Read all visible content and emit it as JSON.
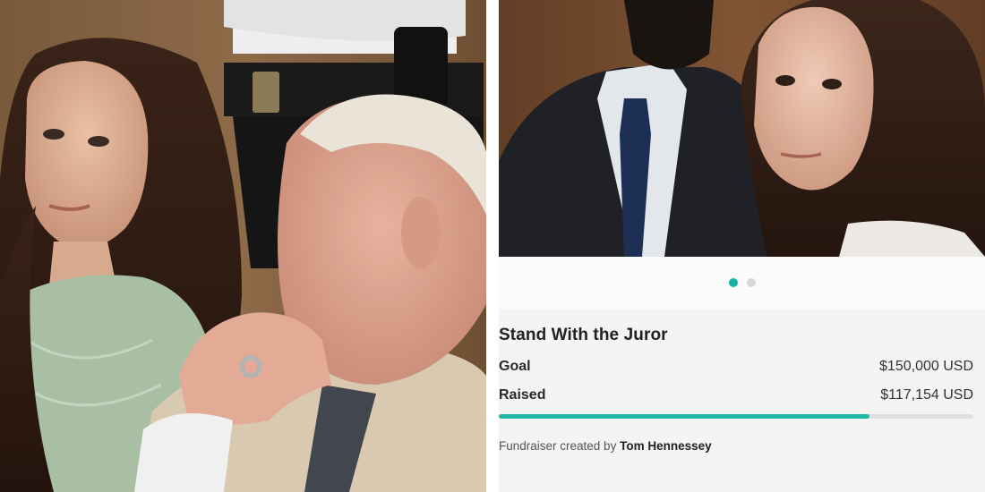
{
  "left_photo": {
    "alt": "courtroom photo"
  },
  "right_photo": {
    "alt": "courtroom photo"
  },
  "carousel": {
    "active_index": 0,
    "count": 2
  },
  "fundraiser": {
    "title": "Stand With the Juror",
    "goal_label": "Goal",
    "goal_value": "$150,000 USD",
    "raised_label": "Raised",
    "raised_value": "$117,154 USD",
    "progress_fraction": 0.781,
    "created_by_prefix": "Fundraiser created by",
    "created_by_name": "Tom Hennessey"
  },
  "colors": {
    "accent": "#16b3a6",
    "progress": "#21b5a5",
    "card_bg": "#f4f4f2"
  }
}
